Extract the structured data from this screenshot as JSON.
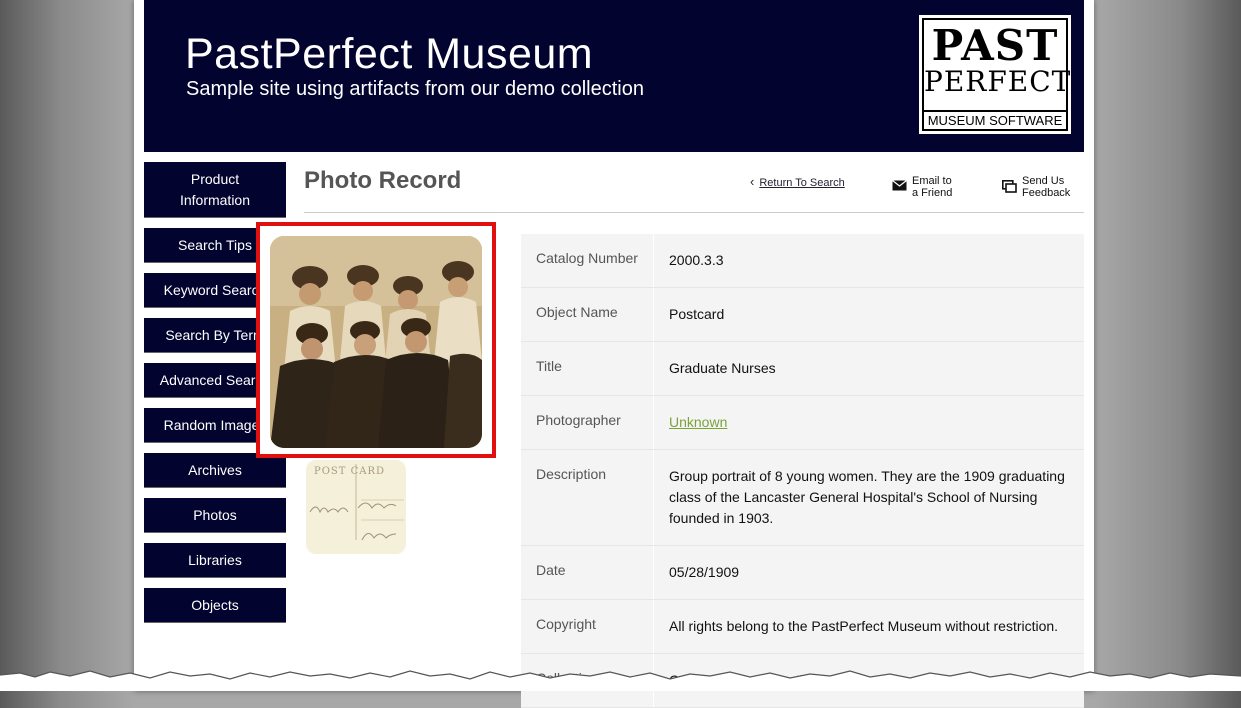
{
  "header": {
    "title": "PastPerfect Museum",
    "subtitle": "Sample site using artifacts from our demo collection",
    "logo": {
      "line1": "PAST",
      "line2": "PERFECT",
      "line3": "MUSEUM SOFTWARE"
    },
    "colors": {
      "header_bg": "#02032f",
      "text": "#ffffff"
    }
  },
  "sidebar": {
    "items": [
      {
        "label": "Product Information"
      },
      {
        "label": "Search Tips"
      },
      {
        "label": "Keyword Search"
      },
      {
        "label": "Search By Term"
      },
      {
        "label": "Advanced Search"
      },
      {
        "label": "Random Images"
      },
      {
        "label": "Archives"
      },
      {
        "label": "Photos"
      },
      {
        "label": "Libraries"
      },
      {
        "label": "Objects"
      }
    ]
  },
  "content": {
    "title": "Photo Record",
    "return_link": "Return To Search",
    "email_action": {
      "line1": "Email to",
      "line2": "a Friend",
      "icon": "envelope-icon"
    },
    "feedback_action": {
      "line1": "Send Us",
      "line2": "Feedback",
      "icon": "feedback-icon"
    },
    "main_image_highlight_color": "#e01010",
    "thumbnail_text": "POST CARD"
  },
  "record": {
    "rows": [
      {
        "label": "Catalog Number",
        "value": "2000.3.3"
      },
      {
        "label": "Object Name",
        "value": "Postcard"
      },
      {
        "label": "Title",
        "value": "Graduate Nurses"
      },
      {
        "label": "Photographer",
        "value": "Unknown",
        "link": true,
        "link_color": "#7ba33a"
      },
      {
        "label": "Description",
        "value": "Group portrait of 8 young women. They are the 1909 graduating class of the Lancaster General Hospital's School of Nursing founded in 1903."
      },
      {
        "label": "Date",
        "value": "05/28/1909"
      },
      {
        "label": "Copyright",
        "value": "All rights belong to the PastPerfect Museum without restriction."
      },
      {
        "label": "Collection",
        "value": "Carter Family Collection"
      }
    ]
  }
}
